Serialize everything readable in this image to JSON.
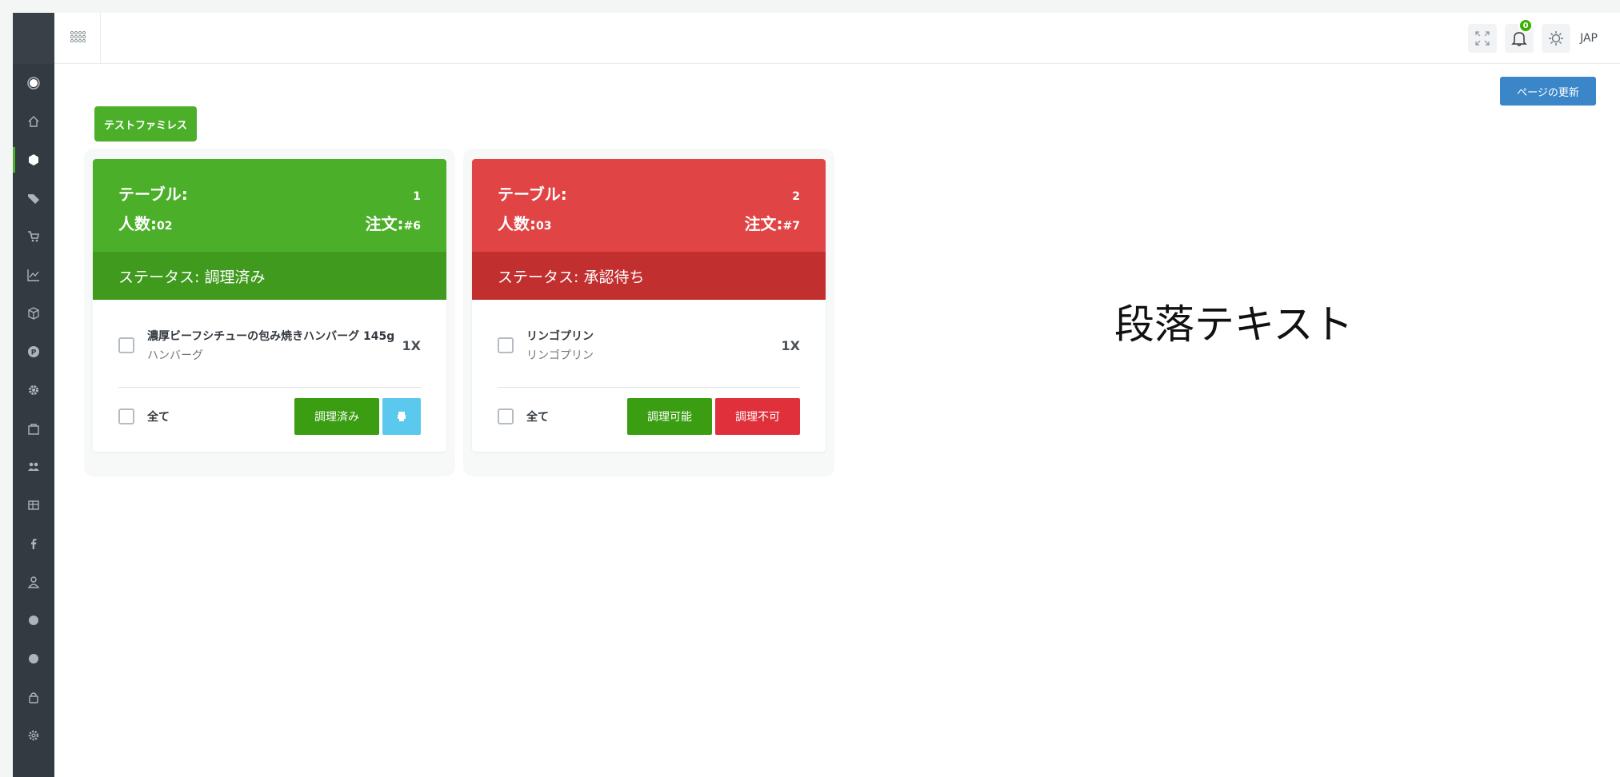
{
  "sidebar": {
    "icons": [
      "circle-logo-icon",
      "home-icon",
      "cube-icon",
      "tag-icon",
      "cart-icon",
      "chart-icon",
      "box-icon",
      "p-badge-icon",
      "gear-small-icon",
      "bag-icon",
      "users-icon",
      "table-icon",
      "facebook-icon",
      "user-icon",
      "dot-icon",
      "dot-icon-2",
      "lock-icon",
      "settings-icon"
    ],
    "active_index": 2
  },
  "topbar": {
    "notification_count": "0",
    "language": "JAP"
  },
  "refresh_button": "ページの更新",
  "store_name": "テストファミレス",
  "cards": [
    {
      "color": "#4caf2a",
      "table_label": "テーブル:",
      "table_number": "1",
      "people_label": "人数:",
      "people_count": "02",
      "order_label": "注文:",
      "order_number": "#6",
      "status": "ステータス: 調理済み",
      "item_name": "濃厚ビーフシチューの包み焼きハンバーグ 145g",
      "item_sub": "ハンバーグ",
      "item_qty": "1X",
      "select_all": "全て",
      "button_primary": "調理済み"
    },
    {
      "color": "#e04444",
      "table_label": "テーブル:",
      "table_number": "2",
      "people_label": "人数:",
      "people_count": "03",
      "order_label": "注文:",
      "order_number": "#7",
      "status": "ステータス: 承認待ち",
      "item_name": "リンゴプリン",
      "item_sub": "リンゴプリン",
      "item_qty": "1X",
      "select_all": "全て",
      "button_primary": "調理可能",
      "button_secondary": "調理不可"
    }
  ],
  "paragraph_text": "段落テキスト"
}
